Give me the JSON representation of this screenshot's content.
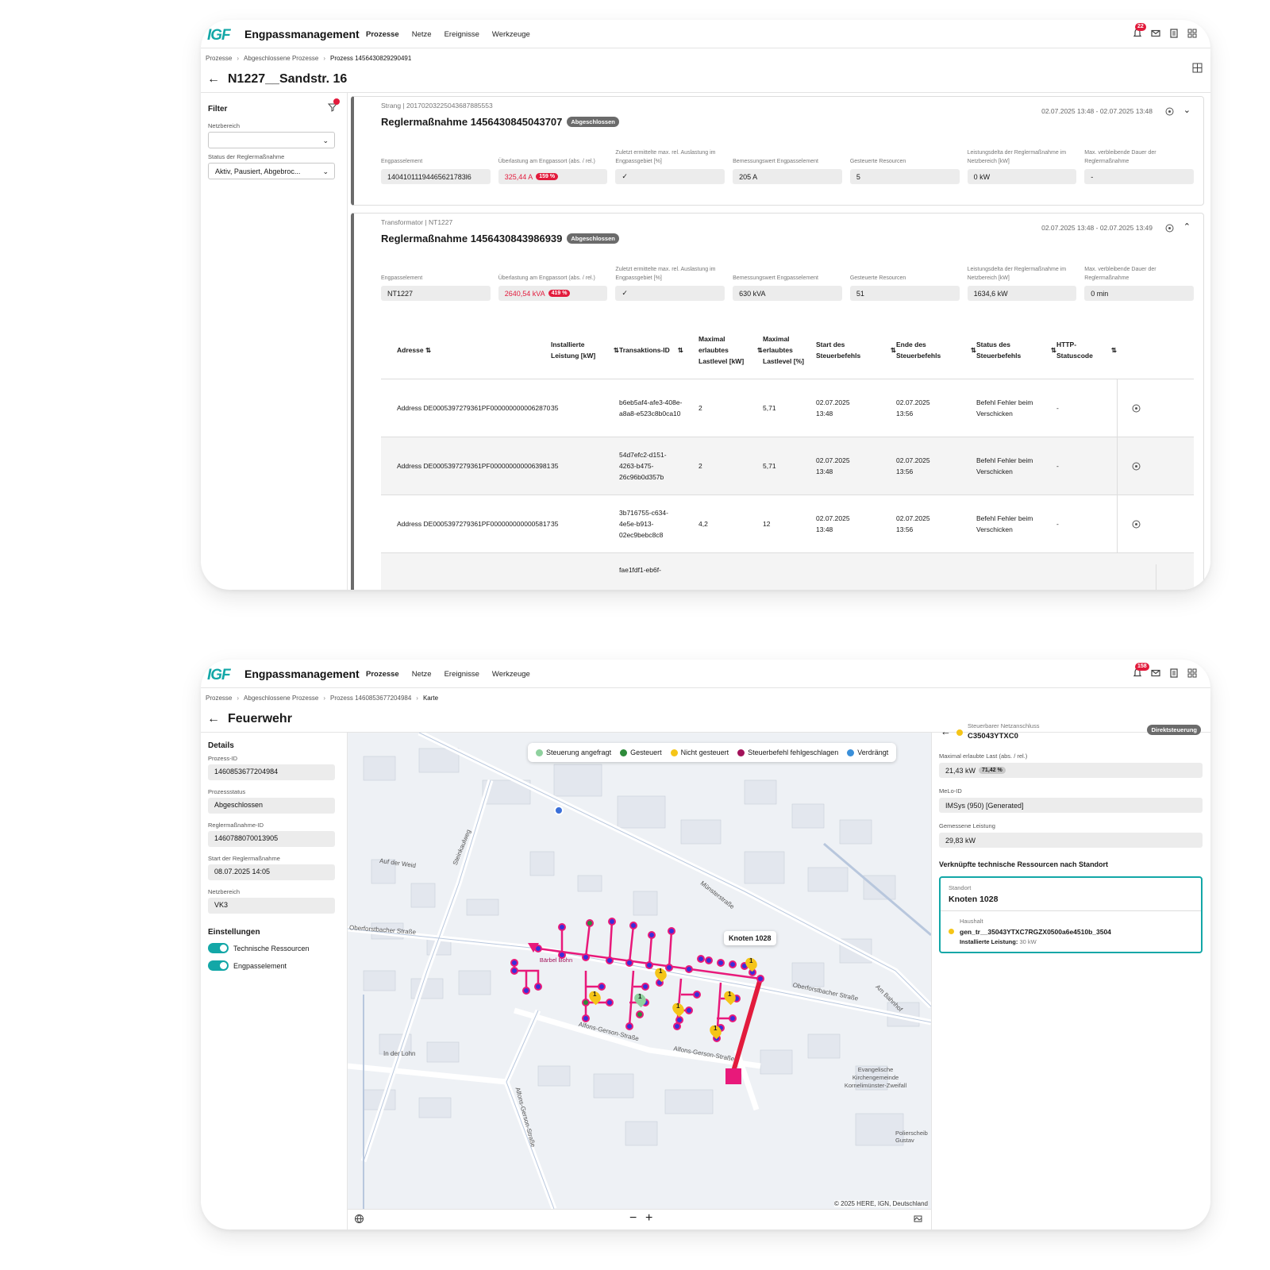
{
  "app": {
    "logo": "IGF",
    "title": "Engpassmanagement",
    "nav": [
      "Prozesse",
      "Netze",
      "Ereignisse",
      "Werkzeuge"
    ]
  },
  "screen1": {
    "notif_count": "22",
    "breadcrumb": [
      "Prozesse",
      "Abgeschlossene Prozesse",
      "Prozess 1456430829290491"
    ],
    "title": "N1227__Sandstr. 16",
    "filter": {
      "title": "Filter",
      "netzbereich_label": "Netzbereich",
      "netzbereich_value": "",
      "status_label": "Status der Reglermaßnahme",
      "status_value": "Aktiv, Pausiert, Abgebroc..."
    },
    "metric_labels": [
      "Engpasselement",
      "Überlastung am Engpassort (abs. / rel.)",
      "Zuletzt ermittelte max. rel. Auslastung im Engpassgebiet [%]",
      "Bemessungswert Engpasselement",
      "Gesteuerte Resourcen",
      "Leistungsdelta der Reglermaßnahme im Netzbereich [kW]",
      "Max. verbleibende Dauer der Reglermaßnahme"
    ],
    "cards": [
      {
        "subtitle": "Strang | 20170203225043687885553",
        "title": "Reglermaßnahme 1456430845043707",
        "status": "Abgeschlossen",
        "dates": "02.07.2025 13:48 - 02.07.2025 13:48",
        "values": [
          "14041011194465621783l6",
          "325,44 A",
          "✓",
          "205 A",
          "5",
          "0 kW",
          "-"
        ],
        "overload_pct": "159 %"
      },
      {
        "subtitle": "Transformator | NT1227",
        "title": "Reglermaßnahme 1456430843986939",
        "status": "Abgeschlossen",
        "dates": "02.07.2025 13:48 - 02.07.2025 13:49",
        "values": [
          "NT1227",
          "2640,54 kVA",
          "✓",
          "630 kVA",
          "51",
          "1634,6 kW",
          "0 min"
        ],
        "overload_pct": "419 %"
      }
    ],
    "table": {
      "headers": [
        "Adresse",
        "Installierte Leistung [kW]",
        "Transaktions-ID",
        "Maximal erlaubtes Lastlevel [kW]",
        "Maximal erlaubtes Lastlevel [%]",
        "Start des Steuerbefehls",
        "Ende des Steuerbefehls",
        "Status des Steuerbefehls",
        "HTTP-Statuscode"
      ],
      "rows": [
        [
          "Address DE0005397279361PF0000000000062870",
          "35",
          "b6eb5af4-afe3-408e-a8a8-e523c8b0ca10",
          "2",
          "5,71",
          "02.07.2025 13:48",
          "02.07.2025 13:56",
          "Befehl Fehler beim Verschicken",
          "-"
        ],
        [
          "Address DE0005397279361PF0000000000063981",
          "35",
          "54d7efc2-d151-4263-b475-26c96b0d357b",
          "2",
          "5,71",
          "02.07.2025 13:48",
          "02.07.2025 13:56",
          "Befehl Fehler beim Verschicken",
          "-"
        ],
        [
          "Address DE0005397279361PF0000000000005817",
          "35",
          "3b716755-c634-4e5e-b913-02ec9bebc8c8",
          "4,2",
          "12",
          "02.07.2025 13:48",
          "02.07.2025 13:56",
          "Befehl Fehler beim Verschicken",
          "-"
        ],
        [
          "",
          "",
          "fae1fdf1-eb6f-",
          "",
          "",
          "",
          "",
          "",
          ""
        ]
      ]
    }
  },
  "screen2": {
    "notif_count": "158",
    "breadcrumb": [
      "Prozesse",
      "Abgeschlossene Prozesse",
      "Prozess 1460853677204984",
      "Karte"
    ],
    "title": "Feuerwehr",
    "details": {
      "title": "Details",
      "fields": [
        {
          "label": "Prozess-ID",
          "value": "1460853677204984"
        },
        {
          "label": "Prozessstatus",
          "value": "Abgeschlossen"
        },
        {
          "label": "Reglermaßnahme-ID",
          "value": "1460788070013905"
        },
        {
          "label": "Start der Reglermaßnahme",
          "value": "08.07.2025 14:05"
        },
        {
          "label": "Netzbereich",
          "value": "VK3"
        }
      ]
    },
    "settings": {
      "title": "Einstellungen",
      "toggles": [
        "Technische Ressourcen",
        "Engpasselement"
      ]
    },
    "legend": [
      {
        "label": "Steuerung angefragt",
        "color": "#8fd19e"
      },
      {
        "label": "Gesteuert",
        "color": "#2e8b3a"
      },
      {
        "label": "Nicht gesteuert",
        "color": "#f5c518"
      },
      {
        "label": "Steuerbefehl fehlgeschlagen",
        "color": "#a3125a"
      },
      {
        "label": "Verdrängt",
        "color": "#3a8fd9"
      }
    ],
    "map": {
      "streets": [
        "Oberforstbacher Straße",
        "Oberforstbacher Straße",
        "Alfons-Gerson-Straße",
        "Alfons-Gerson-Straße",
        "Münsterstraße",
        "Steinkaulweg",
        "In der Lohn",
        "Am Bahnhof",
        "Auf der Weid",
        "Alfons-Gerson-Straße"
      ],
      "poi": [
        "Evangelische Kirchengemeinde Kornelimünster-Zweifall",
        "Bärbel Bohn",
        "Polierscheib Gustav"
      ],
      "tooltip": "Knoten 1028",
      "marker_label": "1",
      "copyright": "© 2025 HERE, IGN, Deutschland"
    },
    "right_panel": {
      "type_label": "Steuerbarer Netzanschluss",
      "id": "C35043YTXC0",
      "badge": "Direktsteuerung",
      "fields": [
        {
          "label": "Maximal erlaubte Last (abs. / rel.)",
          "value": "21,43 kW",
          "pct": "71,42 %"
        },
        {
          "label": "MeLo-ID",
          "value": "IMSys (950) [Generated]"
        },
        {
          "label": "Gemessene Leistung",
          "value": "29,83 kW"
        }
      ],
      "linked_title": "Verknüpfte technische Ressourcen nach Standort",
      "standort_label": "Standort",
      "standort_value": "Knoten 1028",
      "haushalt_label": "Haushalt",
      "haushalt_value": "gen_tr__35043YTXC7RGZX0500a6e4510b_3504",
      "installed_label": "Installierte Leistung:",
      "installed_value": "30 kW"
    }
  }
}
